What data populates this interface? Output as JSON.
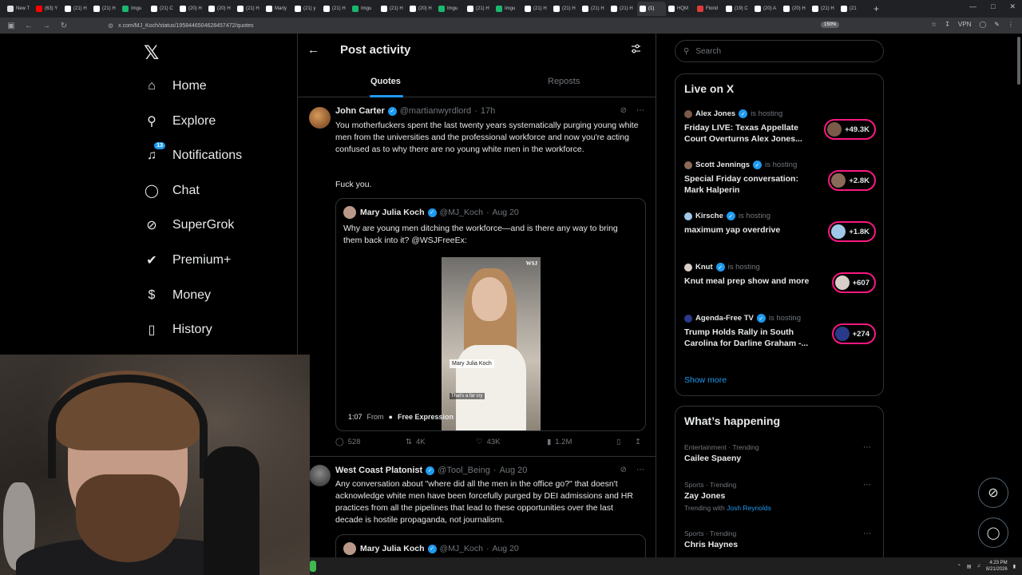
{
  "browser": {
    "tabs": [
      {
        "label": "New T",
        "color": "#e0e0e0"
      },
      {
        "label": "(63) Y",
        "color": "#ff0000"
      },
      {
        "label": "(21) H",
        "color": "#ffffff"
      },
      {
        "label": "(21) H",
        "color": "#ffffff"
      },
      {
        "label": "Imgu",
        "color": "#1bb76e"
      },
      {
        "label": "(21) C",
        "color": "#ffffff"
      },
      {
        "label": "(20) H",
        "color": "#ffffff"
      },
      {
        "label": "(20) H",
        "color": "#ffffff"
      },
      {
        "label": "(21) H",
        "color": "#ffffff"
      },
      {
        "label": "Marty",
        "color": "#ffffff"
      },
      {
        "label": "(21) y",
        "color": "#ffffff"
      },
      {
        "label": "(21) H",
        "color": "#ffffff"
      },
      {
        "label": "Imgu",
        "color": "#1bb76e"
      },
      {
        "label": "(21) H",
        "color": "#ffffff"
      },
      {
        "label": "(20) H",
        "color": "#ffffff"
      },
      {
        "label": "Imgu",
        "color": "#1bb76e"
      },
      {
        "label": "(21) H",
        "color": "#ffffff"
      },
      {
        "label": "Imgu",
        "color": "#1bb76e"
      },
      {
        "label": "(21) H",
        "color": "#ffffff"
      },
      {
        "label": "(21) H",
        "color": "#ffffff"
      },
      {
        "label": "(21) H",
        "color": "#ffffff"
      },
      {
        "label": "(21) H",
        "color": "#ffffff"
      },
      {
        "label": "(1)",
        "color": "#ffffff",
        "active": true
      },
      {
        "label": "HQM",
        "color": "#ffffff"
      },
      {
        "label": "Florid",
        "color": "#e03a3a"
      },
      {
        "label": "(19) C",
        "color": "#ffffff"
      },
      {
        "label": "(20) A",
        "color": "#ffffff"
      },
      {
        "label": "(20) H",
        "color": "#ffffff"
      },
      {
        "label": "(21) H",
        "color": "#ffffff"
      },
      {
        "label": "(21",
        "color": "#ffffff"
      }
    ],
    "url": "x.com/MJ_Koch/status/1958446504628457472/quotes",
    "zoom": "150%",
    "vpn": "VPN"
  },
  "nav": {
    "items": [
      {
        "name": "home",
        "label": "Home",
        "icon": "home-icon"
      },
      {
        "name": "explore",
        "label": "Explore",
        "icon": "search-icon"
      },
      {
        "name": "notifications",
        "label": "Notifications",
        "icon": "bell-icon",
        "badge": "13"
      },
      {
        "name": "chat",
        "label": "Chat",
        "icon": "chat-icon"
      },
      {
        "name": "supergrok",
        "label": "SuperGrok",
        "icon": "grok-icon"
      },
      {
        "name": "premium",
        "label": "Premium+",
        "icon": "verified-icon"
      },
      {
        "name": "money",
        "label": "Money",
        "icon": "dollar-icon"
      },
      {
        "name": "history",
        "label": "History",
        "icon": "bookmark-icon"
      }
    ]
  },
  "center": {
    "title": "Post activity",
    "tabs": [
      "Quotes",
      "Reposts"
    ],
    "posts": [
      {
        "name": "John Carter",
        "handle": "@martianwyrdlord",
        "time": "17h",
        "text": "You motherfuckers spent the last twenty years systematically purging young white men from the universities and the professional workforce and now you're acting confused as to why there are no young white men in the workforce.",
        "text2": "Fuck you.",
        "quote": {
          "name": "Mary Julia Koch",
          "handle": "@MJ_Koch",
          "time": "Aug 20",
          "text": "Why are young men ditching the workforce—and is there any way to bring them back into it? @WSJFreeEx:",
          "video_name_label": "Mary Julia Koch",
          "video_watermark": "WSJ",
          "video_caption": "That's a far cry",
          "duration": "1:07",
          "from_label": "From",
          "source": "Free Expression"
        },
        "replies": "528",
        "reposts": "4K",
        "likes": "43K",
        "views": "1.2M"
      },
      {
        "name": "West Coast Platonist",
        "handle": "@Tool_Being",
        "time": "Aug 20",
        "text": "Any conversation about \"where did all the men in the office go?\" that doesn't acknowledge white men have been forcefully purged by DEI admissions and HR practices from all the pipelines that lead to these opportunities over the last decade is hostile propaganda, not journalism.",
        "quote": {
          "name": "Mary Julia Koch",
          "handle": "@MJ_Koch",
          "time": "Aug 20"
        }
      }
    ]
  },
  "right": {
    "search_placeholder": "Search",
    "live_title": "Live on X",
    "live": [
      {
        "host": "Alex Jones",
        "status": "is hosting",
        "title": "Friday LIVE: Texas Appellate Court Overturns Alex Jones...",
        "count": "+49.3K",
        "avatar_color": "#7a5a48"
      },
      {
        "host": "Scott Jennings",
        "status": "is hosting",
        "title": "Special Friday conversation: Mark Halperin",
        "count": "+2.8K",
        "avatar_color": "#8a6a58"
      },
      {
        "host": "Kirsche",
        "status": "is hosting",
        "title": "maximum yap overdrive",
        "count": "+1.8K",
        "avatar_color": "#9fc8e8"
      },
      {
        "host": "Knut",
        "status": "is hosting",
        "title": "Knut meal prep show and more",
        "count": "+607",
        "avatar_color": "#d8d0c8"
      },
      {
        "host": "Agenda-Free TV",
        "status": "is hosting",
        "title": "Trump Holds Rally in South Carolina for Darline Graham -...",
        "count": "+274",
        "avatar_color": "#2a3a8a"
      }
    ],
    "show_more": "Show more",
    "happening_title": "What’s happening",
    "trends": [
      {
        "category": "Entertainment · Trending",
        "name": "Cailee Spaeny"
      },
      {
        "category": "Sports · Trending",
        "name": "Zay Jones",
        "with_label": "Trending with",
        "with": "Josh Reynolds"
      },
      {
        "category": "Sports · Trending",
        "name": "Chris Haynes"
      }
    ]
  },
  "taskbar": {
    "time": "4:23 PM",
    "date": "8/21/2026"
  },
  "colors": {
    "accent": "#1d9bf0",
    "live_pink": "#f91880",
    "border": "#2f3336",
    "muted": "#71767b"
  }
}
